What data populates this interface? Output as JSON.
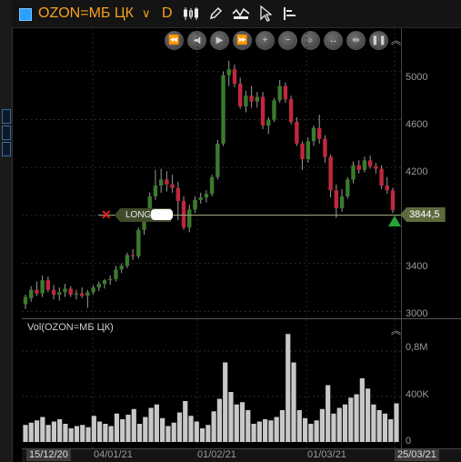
{
  "toolbar": {
    "symbol": "OZON=МБ ЦК",
    "dropdown_glyph": "∨",
    "period": "D",
    "tools": [
      "candles-icon",
      "pencil-icon",
      "indicator-icon",
      "cursor-icon",
      "bars-icon"
    ]
  },
  "price_axis": {
    "labels": [
      "5000",
      "4600",
      "4200",
      "3400",
      "3000"
    ]
  },
  "volume_axis": {
    "labels": [
      "0,8M",
      "400K",
      "0"
    ]
  },
  "volume_title": "Vol(OZON=МБ ЦК)",
  "order_line": {
    "side": "LONG",
    "close_glyph": "✕"
  },
  "last_price": "3844,5",
  "dates": [
    "15/12/20",
    "04/01/21",
    "01/02/21",
    "01/03/21",
    "25/03/21"
  ],
  "colors": {
    "up": "#3c7a2c",
    "down": "#c1273f",
    "symbol": "#f5a21e",
    "volume": "#c8c8c8"
  },
  "chart_data": {
    "type": "candlestick",
    "y_label": "",
    "ylim": [
      2950,
      5150
    ],
    "candles": [
      {
        "o": 3060,
        "h": 3140,
        "l": 3020,
        "c": 3120
      },
      {
        "o": 3110,
        "h": 3210,
        "l": 3080,
        "c": 3180
      },
      {
        "o": 3180,
        "h": 3250,
        "l": 3130,
        "c": 3150
      },
      {
        "o": 3150,
        "h": 3300,
        "l": 3120,
        "c": 3260
      },
      {
        "o": 3260,
        "h": 3290,
        "l": 3160,
        "c": 3180
      },
      {
        "o": 3180,
        "h": 3220,
        "l": 3100,
        "c": 3140
      },
      {
        "o": 3140,
        "h": 3200,
        "l": 3090,
        "c": 3160
      },
      {
        "o": 3160,
        "h": 3230,
        "l": 3120,
        "c": 3190
      },
      {
        "o": 3190,
        "h": 3210,
        "l": 3120,
        "c": 3140
      },
      {
        "o": 3140,
        "h": 3180,
        "l": 3100,
        "c": 3150
      },
      {
        "o": 3150,
        "h": 3200,
        "l": 3110,
        "c": 3130
      },
      {
        "o": 3130,
        "h": 3180,
        "l": 3030,
        "c": 3160
      },
      {
        "o": 3160,
        "h": 3220,
        "l": 3140,
        "c": 3200
      },
      {
        "o": 3200,
        "h": 3250,
        "l": 3170,
        "c": 3230
      },
      {
        "o": 3230,
        "h": 3270,
        "l": 3190,
        "c": 3260
      },
      {
        "o": 3260,
        "h": 3300,
        "l": 3220,
        "c": 3270
      },
      {
        "o": 3270,
        "h": 3380,
        "l": 3250,
        "c": 3350
      },
      {
        "o": 3350,
        "h": 3400,
        "l": 3320,
        "c": 3380
      },
      {
        "o": 3380,
        "h": 3490,
        "l": 3360,
        "c": 3470
      },
      {
        "o": 3470,
        "h": 3520,
        "l": 3430,
        "c": 3460
      },
      {
        "o": 3460,
        "h": 3700,
        "l": 3440,
        "c": 3680
      },
      {
        "o": 3680,
        "h": 3820,
        "l": 3640,
        "c": 3790
      },
      {
        "o": 3790,
        "h": 3990,
        "l": 3760,
        "c": 3960
      },
      {
        "o": 3960,
        "h": 4180,
        "l": 3930,
        "c": 4050
      },
      {
        "o": 4050,
        "h": 4190,
        "l": 3990,
        "c": 4100
      },
      {
        "o": 4100,
        "h": 4170,
        "l": 4000,
        "c": 4060
      },
      {
        "o": 4060,
        "h": 4140,
        "l": 3990,
        "c": 4030
      },
      {
        "o": 4030,
        "h": 4080,
        "l": 3760,
        "c": 3920
      },
      {
        "o": 3920,
        "h": 3960,
        "l": 3680,
        "c": 3700
      },
      {
        "o": 3700,
        "h": 3890,
        "l": 3660,
        "c": 3850
      },
      {
        "o": 3850,
        "h": 3960,
        "l": 3820,
        "c": 3930
      },
      {
        "o": 3930,
        "h": 3990,
        "l": 3900,
        "c": 3950
      },
      {
        "o": 3950,
        "h": 4010,
        "l": 3910,
        "c": 3980
      },
      {
        "o": 3980,
        "h": 4140,
        "l": 3960,
        "c": 4120
      },
      {
        "o": 4120,
        "h": 4430,
        "l": 4100,
        "c": 4400
      },
      {
        "o": 4400,
        "h": 5000,
        "l": 4380,
        "c": 4970
      },
      {
        "o": 4970,
        "h": 5090,
        "l": 4880,
        "c": 5020
      },
      {
        "o": 5020,
        "h": 5060,
        "l": 4870,
        "c": 4900
      },
      {
        "o": 4900,
        "h": 4950,
        "l": 4690,
        "c": 4710
      },
      {
        "o": 4710,
        "h": 4840,
        "l": 4660,
        "c": 4800
      },
      {
        "o": 4800,
        "h": 4880,
        "l": 4700,
        "c": 4750
      },
      {
        "o": 4750,
        "h": 4830,
        "l": 4700,
        "c": 4790
      },
      {
        "o": 4790,
        "h": 4830,
        "l": 4520,
        "c": 4550
      },
      {
        "o": 4550,
        "h": 4620,
        "l": 4480,
        "c": 4600
      },
      {
        "o": 4600,
        "h": 4780,
        "l": 4580,
        "c": 4760
      },
      {
        "o": 4760,
        "h": 4930,
        "l": 4740,
        "c": 4880
      },
      {
        "o": 4880,
        "h": 4910,
        "l": 4740,
        "c": 4770
      },
      {
        "o": 4770,
        "h": 4800,
        "l": 4560,
        "c": 4580
      },
      {
        "o": 4580,
        "h": 4620,
        "l": 4380,
        "c": 4400
      },
      {
        "o": 4400,
        "h": 4420,
        "l": 4180,
        "c": 4270
      },
      {
        "o": 4270,
        "h": 4450,
        "l": 4240,
        "c": 4420
      },
      {
        "o": 4420,
        "h": 4550,
        "l": 4380,
        "c": 4530
      },
      {
        "o": 4530,
        "h": 4640,
        "l": 4400,
        "c": 4440
      },
      {
        "o": 4440,
        "h": 4470,
        "l": 4240,
        "c": 4290
      },
      {
        "o": 4290,
        "h": 4310,
        "l": 3950,
        "c": 4010
      },
      {
        "o": 4010,
        "h": 4060,
        "l": 3780,
        "c": 3860
      },
      {
        "o": 3860,
        "h": 4020,
        "l": 3830,
        "c": 3960
      },
      {
        "o": 3960,
        "h": 4120,
        "l": 3940,
        "c": 4100
      },
      {
        "o": 4100,
        "h": 4250,
        "l": 4070,
        "c": 4220
      },
      {
        "o": 4220,
        "h": 4260,
        "l": 4150,
        "c": 4180
      },
      {
        "o": 4180,
        "h": 4290,
        "l": 4160,
        "c": 4260
      },
      {
        "o": 4260,
        "h": 4300,
        "l": 4190,
        "c": 4210
      },
      {
        "o": 4210,
        "h": 4240,
        "l": 4150,
        "c": 4190
      },
      {
        "o": 4190,
        "h": 4220,
        "l": 4020,
        "c": 4050
      },
      {
        "o": 4050,
        "h": 4120,
        "l": 3980,
        "c": 4010
      },
      {
        "o": 4010,
        "h": 4030,
        "l": 3820,
        "c": 3845
      }
    ],
    "volume_ylim": [
      0,
      1000000
    ],
    "volumes": [
      150000,
      170000,
      190000,
      220000,
      150000,
      180000,
      200000,
      160000,
      120000,
      140000,
      150000,
      130000,
      230000,
      180000,
      160000,
      140000,
      250000,
      200000,
      240000,
      290000,
      160000,
      220000,
      300000,
      330000,
      210000,
      140000,
      170000,
      260000,
      360000,
      230000,
      180000,
      120000,
      150000,
      270000,
      380000,
      700000,
      440000,
      330000,
      350000,
      280000,
      160000,
      180000,
      200000,
      190000,
      220000,
      280000,
      950000,
      700000,
      280000,
      210000,
      160000,
      190000,
      290000,
      500000,
      250000,
      300000,
      330000,
      390000,
      420000,
      560000,
      470000,
      330000,
      280000,
      250000,
      200000,
      340000
    ]
  }
}
